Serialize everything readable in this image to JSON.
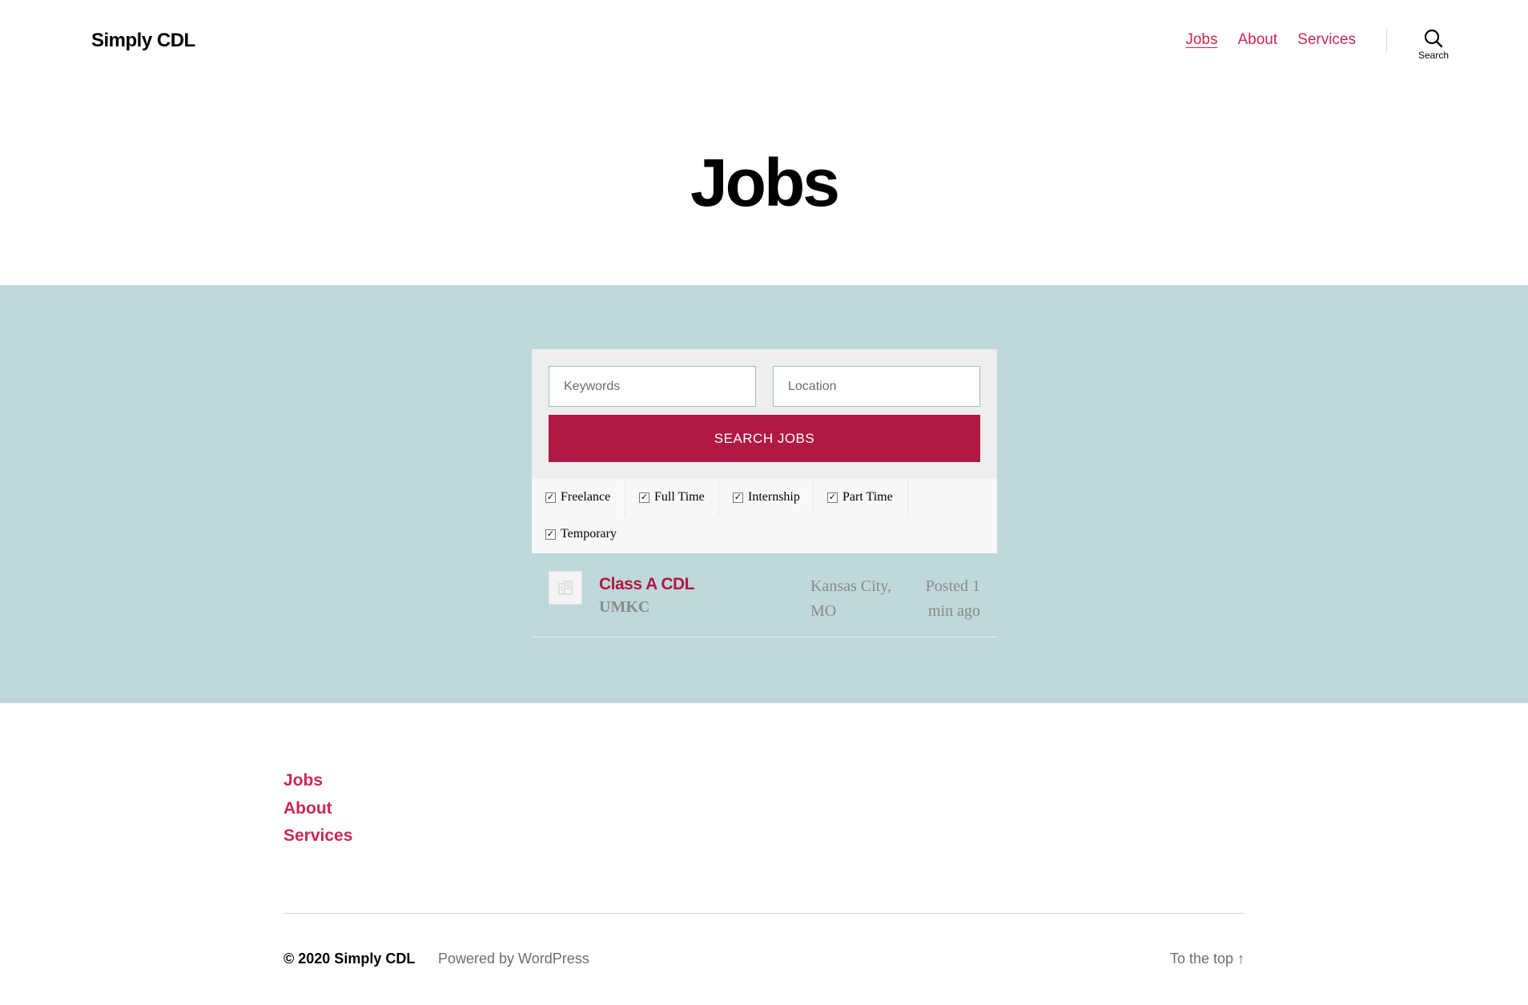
{
  "header": {
    "site_title": "Simply CDL",
    "nav": [
      "Jobs",
      "About",
      "Services"
    ],
    "search_label": "Search"
  },
  "page_title": "Jobs",
  "job_search": {
    "keywords_placeholder": "Keywords",
    "location_placeholder": "Location",
    "button_label": "SEARCH JOBS",
    "filters": [
      {
        "label": "Freelance",
        "checked": true
      },
      {
        "label": "Full Time",
        "checked": true
      },
      {
        "label": "Internship",
        "checked": true
      },
      {
        "label": "Part Time",
        "checked": true
      },
      {
        "label": "Temporary",
        "checked": true
      }
    ]
  },
  "listings": [
    {
      "title": "Class A CDL",
      "company": "UMKC",
      "location": "Kansas City, MO",
      "posted": "Posted 1 min ago"
    }
  ],
  "footer": {
    "menu": [
      "Jobs",
      "About",
      "Services"
    ],
    "copyright": "© 2020 Simply CDL",
    "powered_by": "Powered by WordPress",
    "to_top": "To the top ↑"
  },
  "colors": {
    "accent": "#cd2653",
    "button": "#b01943",
    "band": "#bfd8d9"
  }
}
